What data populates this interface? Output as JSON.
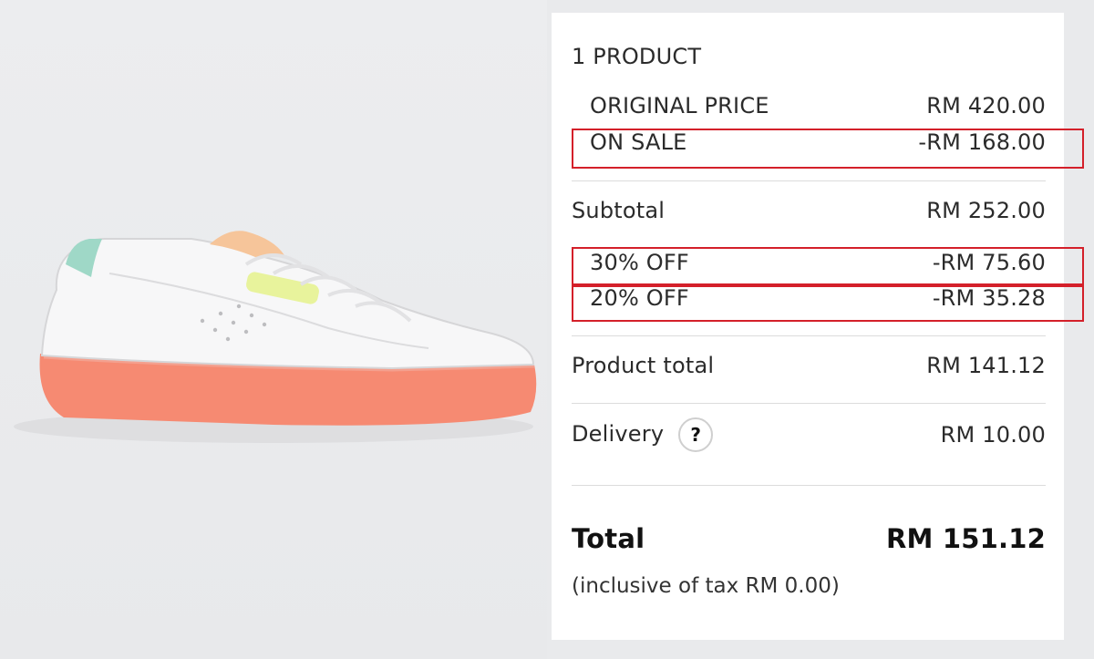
{
  "image": {
    "subject": "sneaker-icon",
    "colors": {
      "upper": "#f7f7f8",
      "sole": "#f68a72",
      "heel_tab": "#9fd8c7",
      "tongue": "#f6c59a",
      "accent": "#e8f39c"
    }
  },
  "summary": {
    "product_count": "1 PRODUCT",
    "original_price": {
      "label": "ORIGINAL PRICE",
      "value": "RM 420.00"
    },
    "on_sale": {
      "label": "ON SALE",
      "value": "-RM 168.00"
    },
    "subtotal": {
      "label": "Subtotal",
      "value": "RM 252.00"
    },
    "discounts": [
      {
        "label": "30% OFF",
        "value": "-RM 75.60"
      },
      {
        "label": "20% OFF",
        "value": "-RM 35.28"
      }
    ],
    "product_total": {
      "label": "Product total",
      "value": "RM 141.12"
    },
    "delivery": {
      "label": "Delivery",
      "help_glyph": "?",
      "value": "RM 10.00"
    },
    "total": {
      "label": "Total",
      "value": "RM 151.12"
    },
    "tax_note": "(inclusive of tax RM 0.00)"
  },
  "highlight_color": "#d4202a"
}
